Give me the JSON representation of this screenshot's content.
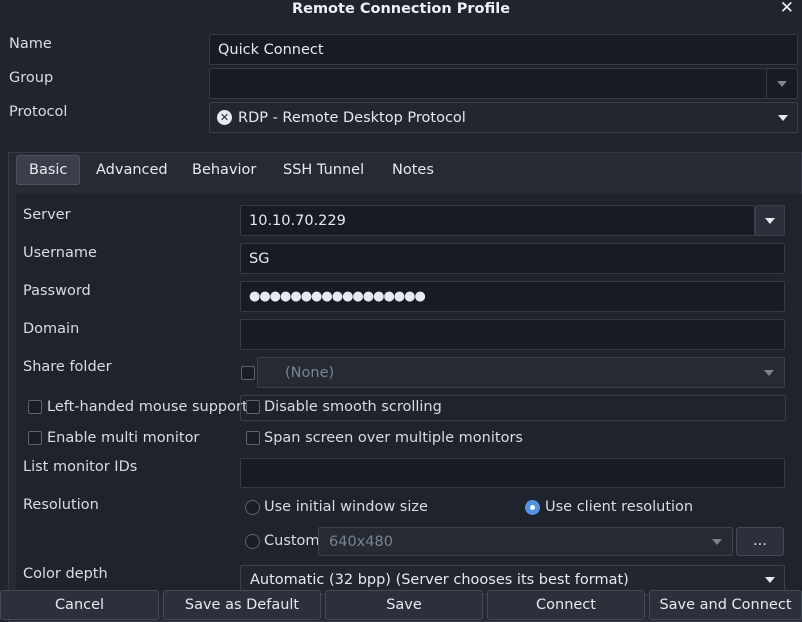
{
  "window": {
    "title": "Remote Connection Profile",
    "close_glyph": "✕"
  },
  "profile": {
    "name_label": "Name",
    "name_value": "Quick Connect",
    "group_label": "Group",
    "group_value": "",
    "protocol_label": "Protocol",
    "protocol_value": "RDP - Remote Desktop Protocol",
    "protocol_icon": "rdp-icon"
  },
  "tabs": [
    "Basic",
    "Advanced",
    "Behavior",
    "SSH Tunnel",
    "Notes"
  ],
  "active_tab": "Basic",
  "basic": {
    "server_label": "Server",
    "server_value": "10.10.70.229",
    "username_label": "Username",
    "username_value": "SG",
    "password_label": "Password",
    "password_value": "●●●●●●●●●●●●●●●●●",
    "domain_label": "Domain",
    "domain_value": "",
    "share_label": "Share folder",
    "share_value": "(None)",
    "left_handed_label": "Left-handed mouse support",
    "disable_smooth_label": "Disable smooth scrolling",
    "multi_monitor_label": "Enable multi monitor",
    "span_screen_label": "Span screen over multiple monitors",
    "monitor_ids_label": "List monitor IDs",
    "monitor_ids_value": "",
    "resolution_label": "Resolution",
    "res_initial_label": "Use initial window size",
    "res_client_label": "Use client resolution",
    "res_custom_label": "Custom",
    "res_custom_value": "640x480",
    "res_more_label": "...",
    "color_depth_label": "Color depth",
    "color_depth_value": "Automatic (32 bpp) (Server chooses its best format)"
  },
  "buttons": {
    "cancel": "Cancel",
    "save_default": "Save as Default",
    "save": "Save",
    "connect": "Connect",
    "save_connect": "Save and Connect"
  }
}
